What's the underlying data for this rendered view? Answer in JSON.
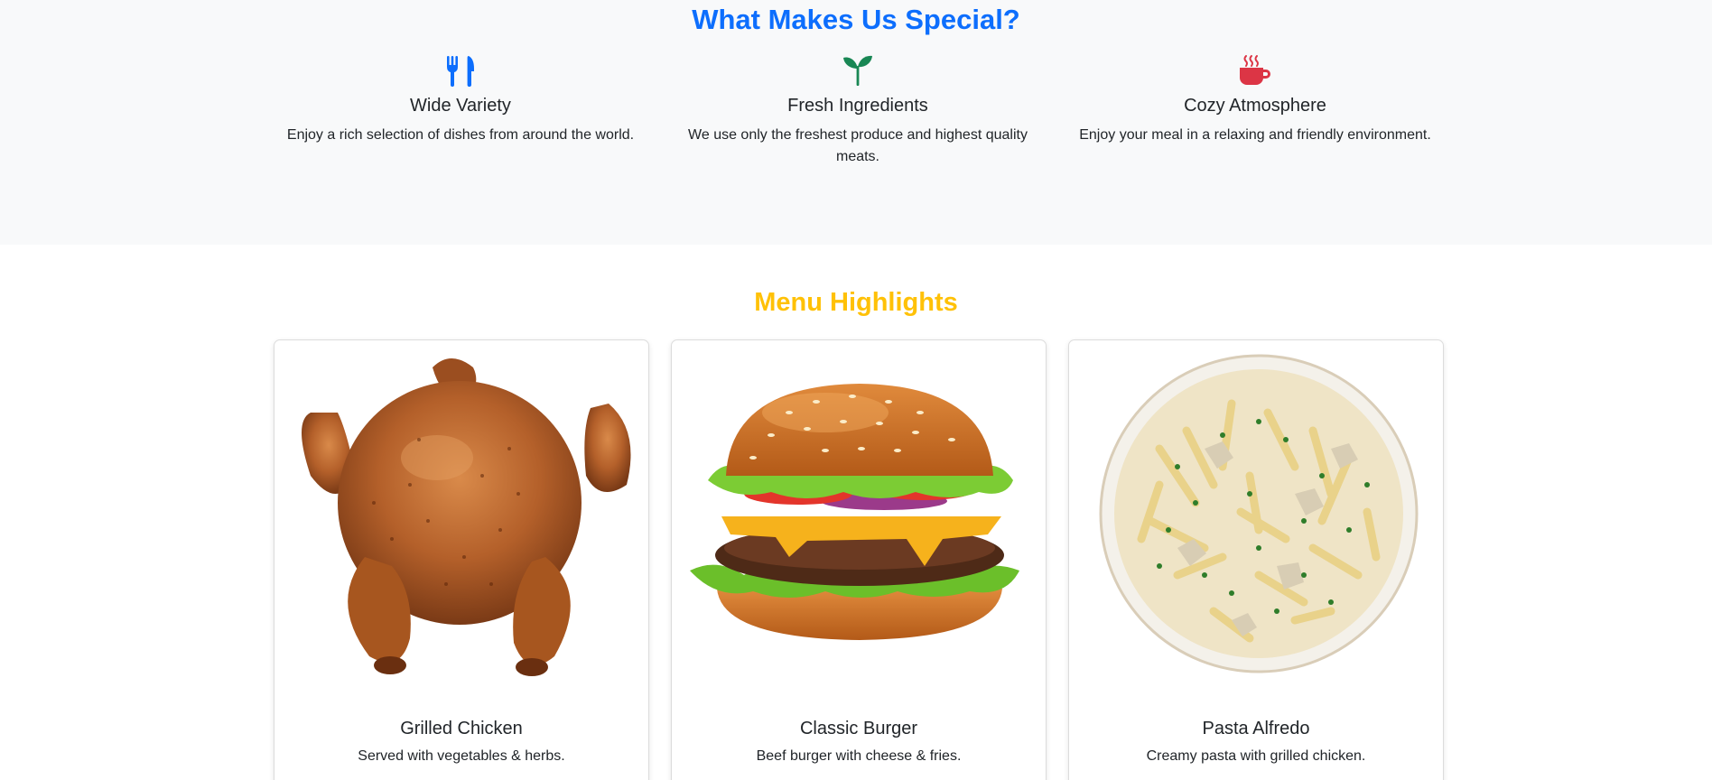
{
  "special": {
    "heading": "What Makes Us Special?",
    "features": [
      {
        "title": "Wide Variety",
        "text": "Enjoy a rich selection of dishes from around the world.",
        "icon": "utensils-icon",
        "color": "#0d6efd"
      },
      {
        "title": "Fresh Ingredients",
        "text": "We use only the freshest produce and highest quality meats.",
        "icon": "sprout-icon",
        "color": "#198754"
      },
      {
        "title": "Cozy Atmosphere",
        "text": "Enjoy your meal in a relaxing and friendly environment.",
        "icon": "coffee-cup-icon",
        "color": "#dc3545"
      }
    ]
  },
  "menu": {
    "heading": "Menu Highlights",
    "items": [
      {
        "title": "Grilled Chicken",
        "text": "Served with vegetables & herbs."
      },
      {
        "title": "Classic Burger",
        "text": "Beef burger with cheese & fries."
      },
      {
        "title": "Pasta Alfredo",
        "text": "Creamy pasta with grilled chicken."
      }
    ]
  },
  "colors": {
    "primary": "#0d6efd",
    "warning": "#ffc107",
    "success": "#198754",
    "danger": "#dc3545",
    "section_bg": "#f8f9fa"
  }
}
